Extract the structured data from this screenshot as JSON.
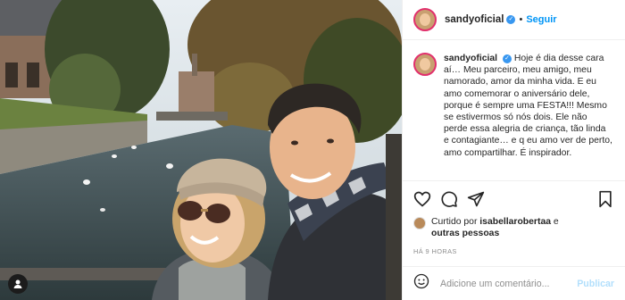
{
  "post": {
    "username": "sandyoficial",
    "follow_label": "Seguir",
    "separator": "•",
    "verified_glyph": "✓",
    "caption": "Hoje é dia desse cara aí… Meu parceiro, meu amigo, meu namorado, amor da minha vida. E eu amo comemorar o aniversário dele, porque é sempre uma FESTA!!! Mesmo se estivermos só nós dois. Ele não perde essa alegria de criança, tão linda e contagiante… e q eu amo ver de perto, amo compartilhar. É inspirador.",
    "liked_prefix": "Curtido por",
    "liked_user": "isabellarobertaa",
    "liked_suffix": "e",
    "liked_others": "outras pessoas",
    "time_ago": "HÁ 9 HORAS",
    "comment_placeholder": "Adicione um comentário...",
    "post_label": "Publicar"
  },
  "icons": {
    "like": "heart-icon",
    "comment": "comment-icon",
    "share": "share-icon",
    "save": "bookmark-icon",
    "emoji": "smiley-icon",
    "tag": "user-tag-icon"
  },
  "colors": {
    "link": "#0095f6",
    "verified": "#3897f0",
    "muted": "#8e8e8e",
    "post_disabled": "#b2dffc"
  }
}
